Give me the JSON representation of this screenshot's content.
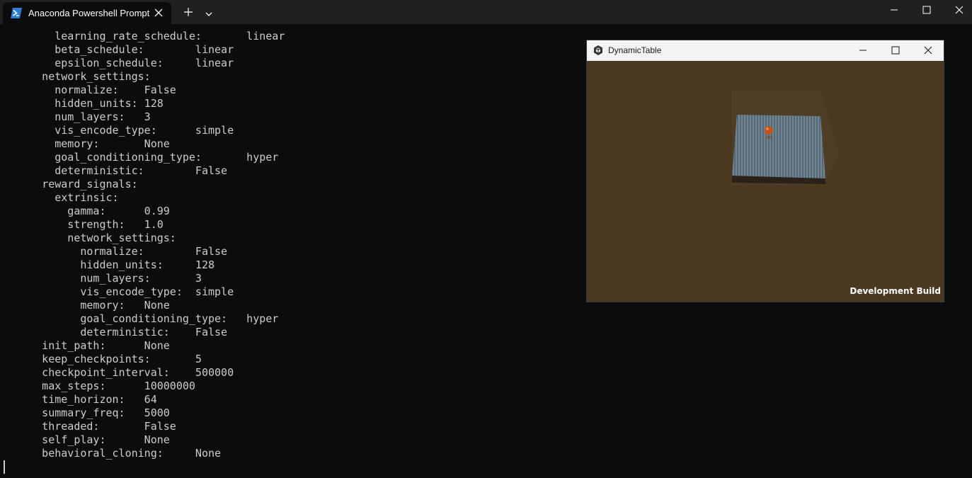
{
  "terminal_window": {
    "tab_title": "Anaconda Powershell Prompt",
    "tab_icon": "powershell-icon",
    "icons": {
      "tab_close": "close-icon",
      "new_tab": "plus-icon",
      "tab_dropdown": "chevron-down-icon",
      "minimize": "minimize-icon",
      "maximize": "maximize-icon",
      "close": "close-icon"
    }
  },
  "terminal": {
    "lines": [
      "        learning_rate_schedule:       linear",
      "        beta_schedule:        linear",
      "        epsilon_schedule:     linear",
      "      network_settings:",
      "        normalize:    False",
      "        hidden_units: 128",
      "        num_layers:   3",
      "        vis_encode_type:      simple",
      "        memory:       None",
      "        goal_conditioning_type:       hyper",
      "        deterministic:        False",
      "      reward_signals:",
      "        extrinsic:",
      "          gamma:      0.99",
      "          strength:   1.0",
      "          network_settings:",
      "            normalize:        False",
      "            hidden_units:     128",
      "            num_layers:       3",
      "            vis_encode_type:  simple",
      "            memory:   None",
      "            goal_conditioning_type:   hyper",
      "            deterministic:    False",
      "      init_path:      None",
      "      keep_checkpoints:       5",
      "      checkpoint_interval:    500000",
      "      max_steps:      10000000",
      "      time_horizon:   64",
      "      summary_freq:   5000",
      "      threaded:       False",
      "      self_play:      None",
      "      behavioral_cloning:     None"
    ]
  },
  "unity_window": {
    "title": "DynamicTable",
    "icon": "unity-icon",
    "watermark": "Development Build",
    "colors": {
      "background": "#4b3820",
      "table": "#7b8f9c",
      "ball": "#c0501c"
    }
  },
  "colors": {
    "terminal_bg": "#0c0c0c",
    "terminal_fg": "#cccccc",
    "titlebar_bg": "#202020"
  }
}
